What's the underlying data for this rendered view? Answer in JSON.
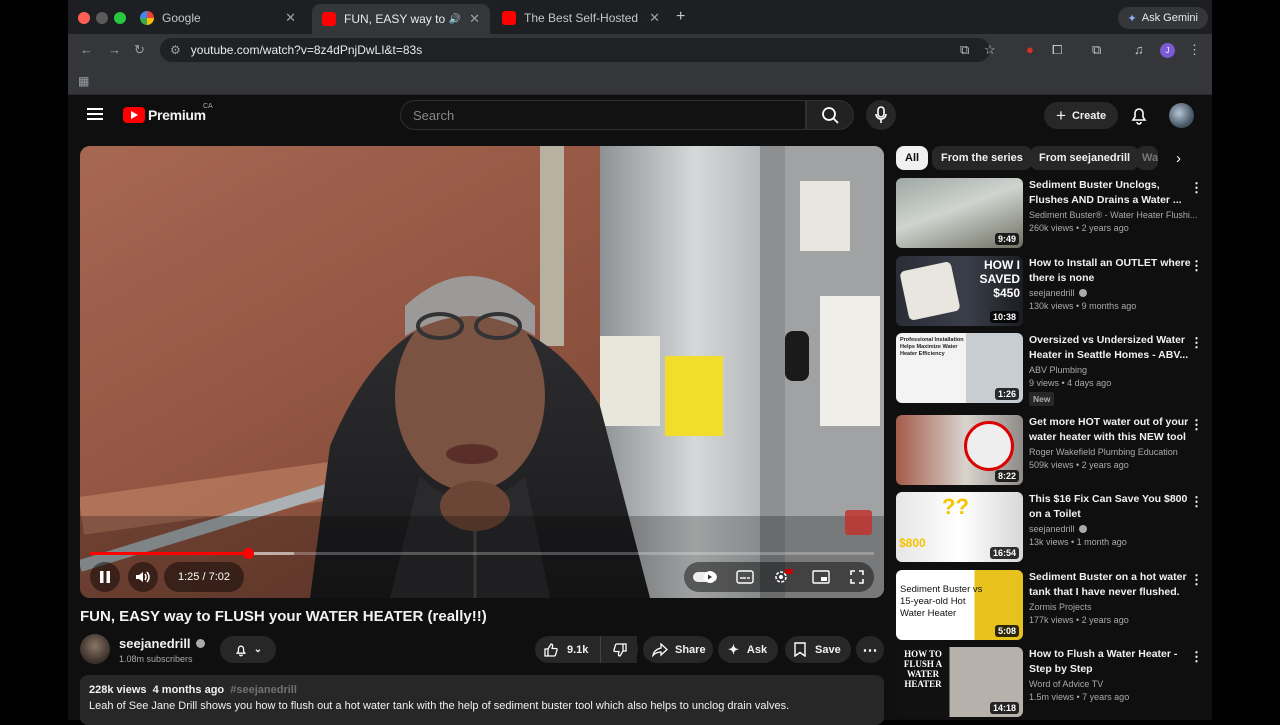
{
  "browser": {
    "tabs": [
      {
        "title": "Google",
        "favicon": "google-icon"
      },
      {
        "title": "FUN, EASY way to FLUSH",
        "favicon": "youtube-icon",
        "active": true
      },
      {
        "title": "The Best Self-Hosted AI Tool",
        "favicon": "youtube-icon"
      }
    ],
    "gemini_label": "Ask Gemini",
    "profile_initial": "J",
    "url": "youtube.com/watch?v=8z4dPnjDwLI&t=83s"
  },
  "youtube": {
    "logo_text": "Premium",
    "region": "CA",
    "search_placeholder": "Search",
    "create_label": "Create"
  },
  "player": {
    "time": "1:25 / 7:02",
    "progress": 0.2014,
    "buffered": 0.26
  },
  "video": {
    "title": "FUN, EASY way to FLUSH your WATER HEATER (really!!)",
    "channel": "seejanedrill",
    "subscribers": "1.08m subscribers",
    "likes": "9.1k",
    "share_label": "Share",
    "ask_label": "Ask",
    "save_label": "Save",
    "views": "228k views",
    "age": "4 months ago",
    "hashtag": "#seejanedrill",
    "description": "Leah of See Jane Drill shows you how to flush out a hot water tank with the help of sediment buster tool which also helps to unclog drain valves."
  },
  "chips": [
    "All",
    "From the series",
    "From seejanedrill",
    "Wa"
  ],
  "recommendations": [
    {
      "title": "Sediment Buster Unclogs, Flushes AND Drains a Water ...",
      "channel": "Sediment Buster® - Water Heater Flushi...",
      "meta": "260k views • 2 years ago",
      "duration": "9:49",
      "verified": false
    },
    {
      "title": "How to Install an OUTLET where there is none",
      "channel": "seejanedrill",
      "meta": "130k views • 9 months ago",
      "duration": "10:38",
      "verified": true,
      "thumb_text": "HOW I SAVED $450"
    },
    {
      "title": "Oversized vs Undersized Water Heater in Seattle Homes - ABV...",
      "channel": "ABV Plumbing",
      "meta": "9 views • 4 days ago",
      "duration": "1:26",
      "verified": false,
      "badge": "New",
      "thumb_text": "Professional Installation Helps Maximize Water Heater Efficiency"
    },
    {
      "title": "Get more HOT water out of your water heater with this NEW tool",
      "channel": "Roger Wakefield Plumbing Education",
      "meta": "509k views • 2 years ago",
      "duration": "8:22",
      "verified": false
    },
    {
      "title": "This $16 Fix Can Save You $800 on a Toilet",
      "channel": "seejanedrill",
      "meta": "13k views • 1 month ago",
      "duration": "16:54",
      "verified": true,
      "thumb_text": "$800"
    },
    {
      "title": "Sediment Buster on a hot water tank that I have never flushed.",
      "channel": "Zormis Projects",
      "meta": "177k views • 2 years ago",
      "duration": "5:08",
      "verified": false,
      "thumb_text": "Sediment Buster vs 15-year-old Hot Water Heater"
    },
    {
      "title": "How to Flush a Water Heater - Step by Step",
      "channel": "Word of Advice TV",
      "meta": "1.5m views • 7 years ago",
      "duration": "14:18",
      "verified": false,
      "thumb_text": "HOW TO FLUSH A WATER HEATER"
    }
  ],
  "colors": {
    "brand_red": "#ff0000",
    "background": "#0f0f0f",
    "surface": "#272727"
  }
}
